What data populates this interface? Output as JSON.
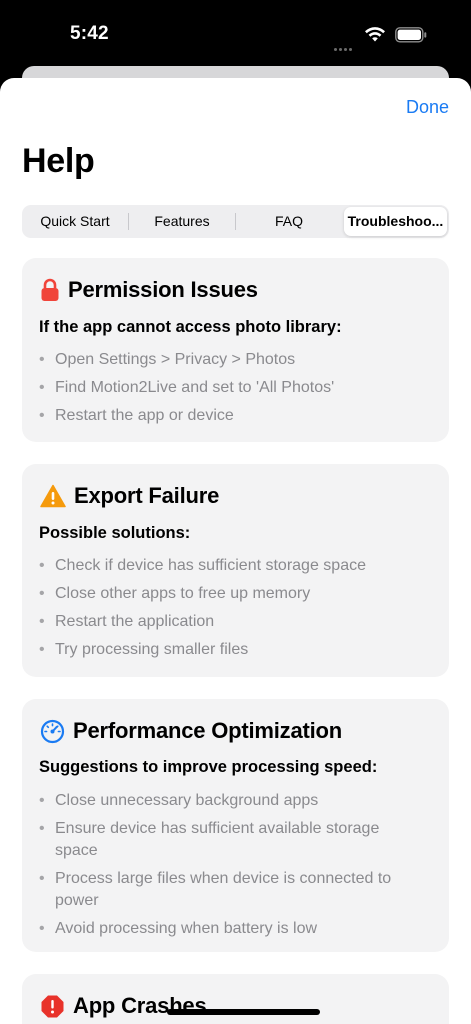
{
  "status_bar": {
    "time": "5:42"
  },
  "header": {
    "done_label": "Done",
    "title": "Help"
  },
  "tabs": [
    {
      "label": "Quick Start",
      "selected": false
    },
    {
      "label": "Features",
      "selected": false
    },
    {
      "label": "FAQ",
      "selected": false
    },
    {
      "label": "Troubleshoo...",
      "selected": true
    }
  ],
  "cards": [
    {
      "icon": "lock-icon",
      "title": "Permission Issues",
      "subtitle": "If the app cannot access photo library:",
      "items": [
        "Open Settings > Privacy > Photos",
        "Find Motion2Live and set to 'All Photos'",
        "Restart the app or device"
      ]
    },
    {
      "icon": "warning-icon",
      "title": "Export Failure",
      "subtitle": "Possible solutions:",
      "items": [
        "Check if device has sufficient storage space",
        "Close other apps to free up memory",
        "Restart the application",
        "Try processing smaller files"
      ]
    },
    {
      "icon": "speedometer-icon",
      "title": "Performance Optimization",
      "subtitle": "Suggestions to improve processing speed:",
      "items": [
        "Close unnecessary background apps",
        "Ensure device has sufficient available storage space",
        "Process large files when device is connected to power",
        "Avoid processing when battery is low"
      ]
    },
    {
      "icon": "stop-sign-icon",
      "title": "App Crashes"
    }
  ],
  "colors": {
    "accent": "#1a7bf3",
    "lock": "#f0443a",
    "warning": "#f59a0c",
    "crash": "#e8322a"
  }
}
